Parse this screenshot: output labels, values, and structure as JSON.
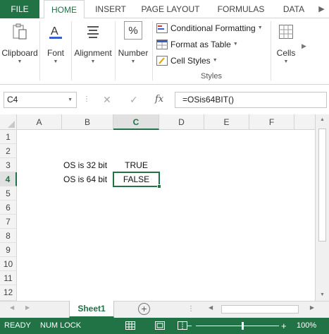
{
  "ribbon_tabs": {
    "file": "FILE",
    "home": "HOME",
    "insert": "INSERT",
    "page_layout": "PAGE LAYOUT",
    "formulas": "FORMULAS",
    "data": "DATA"
  },
  "ribbon": {
    "clipboard": "Clipboard",
    "font": "Font",
    "alignment": "Alignment",
    "number": "Number",
    "number_symbol": "%",
    "conditional_formatting": "Conditional Formatting",
    "format_as_table": "Format as Table",
    "cell_styles": "Cell Styles",
    "styles_group": "Styles",
    "cells": "Cells"
  },
  "formula_bar": {
    "name_box": "C4",
    "cancel": "✕",
    "enter": "✓",
    "fx": "fx",
    "formula": "=OSis64BIT()"
  },
  "grid": {
    "columns": [
      "A",
      "B",
      "C",
      "D",
      "E",
      "F"
    ],
    "rows": [
      "1",
      "2",
      "3",
      "4",
      "5",
      "6",
      "7",
      "8",
      "9",
      "10",
      "11",
      "12"
    ],
    "selected_column": "C",
    "selected_row": "4",
    "cells": {
      "B3": "OS is 32 bit",
      "C3": "TRUE",
      "B4": "OS is 64 bit",
      "C4": "FALSE"
    }
  },
  "sheets": {
    "active": "Sheet1",
    "add_symbol": "+"
  },
  "status_bar": {
    "ready": "READY",
    "num_lock": "NUM LOCK",
    "zoom": "100%",
    "zoom_minus": "−",
    "zoom_plus": "+"
  },
  "colors": {
    "accent": "#217346"
  }
}
